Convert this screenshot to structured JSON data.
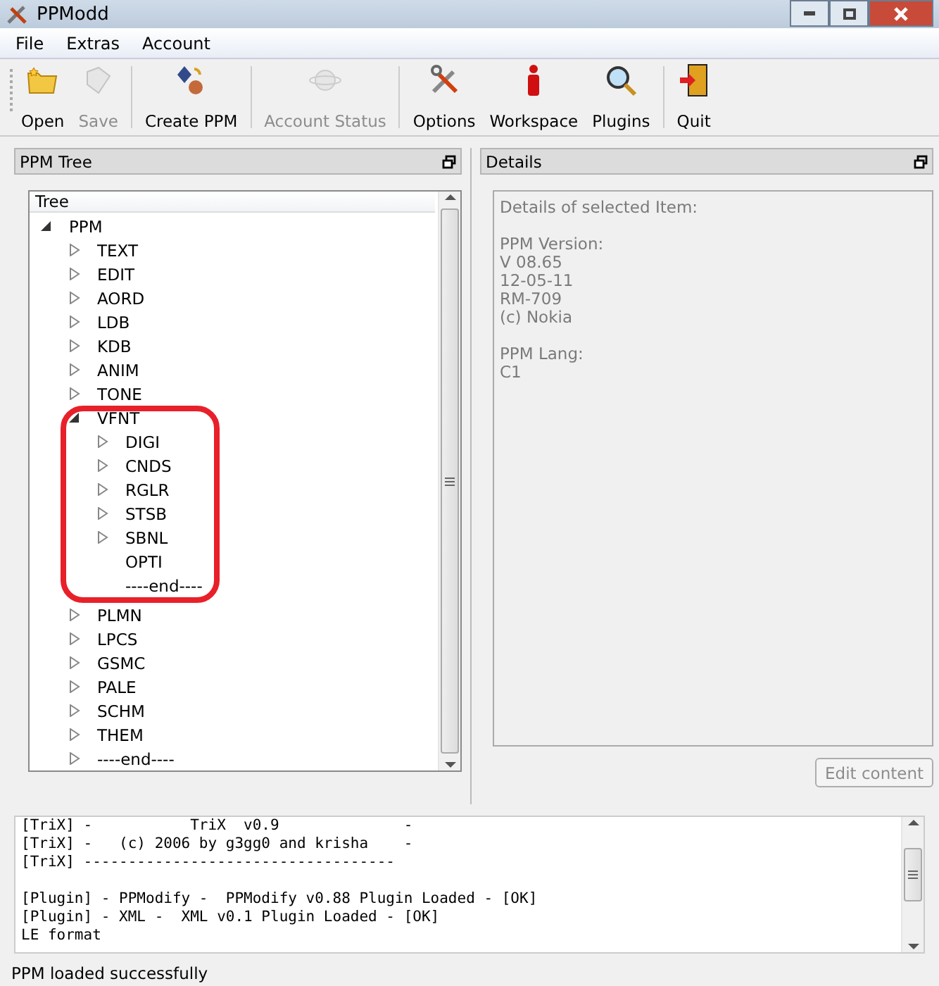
{
  "window": {
    "title": "PPModd"
  },
  "menu": [
    "File",
    "Extras",
    "Account"
  ],
  "toolbar_groups": [
    [
      {
        "label": "Open",
        "disabled": false
      },
      {
        "label": "Save",
        "disabled": true
      }
    ],
    [
      {
        "label": "Create PPM",
        "disabled": false
      }
    ],
    [
      {
        "label": "Account Status",
        "disabled": true
      }
    ],
    [
      {
        "label": "Options",
        "disabled": false
      },
      {
        "label": "Workspace",
        "disabled": false
      },
      {
        "label": "Plugins",
        "disabled": false
      }
    ],
    [
      {
        "label": "Quit",
        "disabled": false
      }
    ]
  ],
  "tree_panel": {
    "title": "PPM Tree",
    "column": "Tree",
    "nodes": [
      {
        "label": "PPM",
        "expandable": true,
        "expanded": true,
        "highlighted": false,
        "children": [
          {
            "label": "TEXT",
            "expandable": true,
            "expanded": false
          },
          {
            "label": "EDIT",
            "expandable": true,
            "expanded": false
          },
          {
            "label": "AORD",
            "expandable": true,
            "expanded": false
          },
          {
            "label": "LDB",
            "expandable": true,
            "expanded": false
          },
          {
            "label": "KDB",
            "expandable": true,
            "expanded": false
          },
          {
            "label": "ANIM",
            "expandable": true,
            "expanded": false
          },
          {
            "label": "TONE",
            "expandable": true,
            "expanded": false
          },
          {
            "label": "VFNT",
            "expandable": true,
            "expanded": true,
            "highlighted": true,
            "children": [
              {
                "label": "DIGI",
                "expandable": true,
                "expanded": false
              },
              {
                "label": "CNDS",
                "expandable": true,
                "expanded": false
              },
              {
                "label": "RGLR",
                "expandable": true,
                "expanded": false
              },
              {
                "label": "STSB",
                "expandable": true,
                "expanded": false
              },
              {
                "label": "SBNL",
                "expandable": true,
                "expanded": false
              },
              {
                "label": "OPTI",
                "expandable": false
              },
              {
                "label": "----end----",
                "expandable": false
              }
            ]
          },
          {
            "label": "PLMN",
            "expandable": true,
            "expanded": false
          },
          {
            "label": "LPCS",
            "expandable": true,
            "expanded": false
          },
          {
            "label": "GSMC",
            "expandable": true,
            "expanded": false
          },
          {
            "label": "PALE",
            "expandable": true,
            "expanded": false
          },
          {
            "label": "SCHM",
            "expandable": true,
            "expanded": false
          },
          {
            "label": "THEM",
            "expandable": true,
            "expanded": false
          },
          {
            "label": "----end----",
            "expandable": true,
            "expanded": false
          }
        ]
      }
    ]
  },
  "details_panel": {
    "title": "Details",
    "paragraphs": [
      [
        "Details of selected Item:"
      ],
      [
        "PPM Version:",
        "V 08.65",
        "12-05-11",
        "RM-709",
        "(c) Nokia"
      ],
      [
        "PPM Lang:",
        "C1"
      ]
    ],
    "button": {
      "label": "Edit content",
      "disabled": true
    }
  },
  "log_blocks": [
    [
      "[TriX] -           TriX  v0.9              -",
      "[TriX] -   (c) 2006 by g3gg0 and krisha    -",
      "[TriX] -----------------------------------"
    ],
    [
      "[Plugin] - PPModify -  PPModify v0.88 Plugin Loaded - [OK]",
      "[Plugin] - XML -  XML v0.1 Plugin Loaded - [OK]",
      "LE format"
    ]
  ],
  "status_bar": "PPM loaded successfully"
}
